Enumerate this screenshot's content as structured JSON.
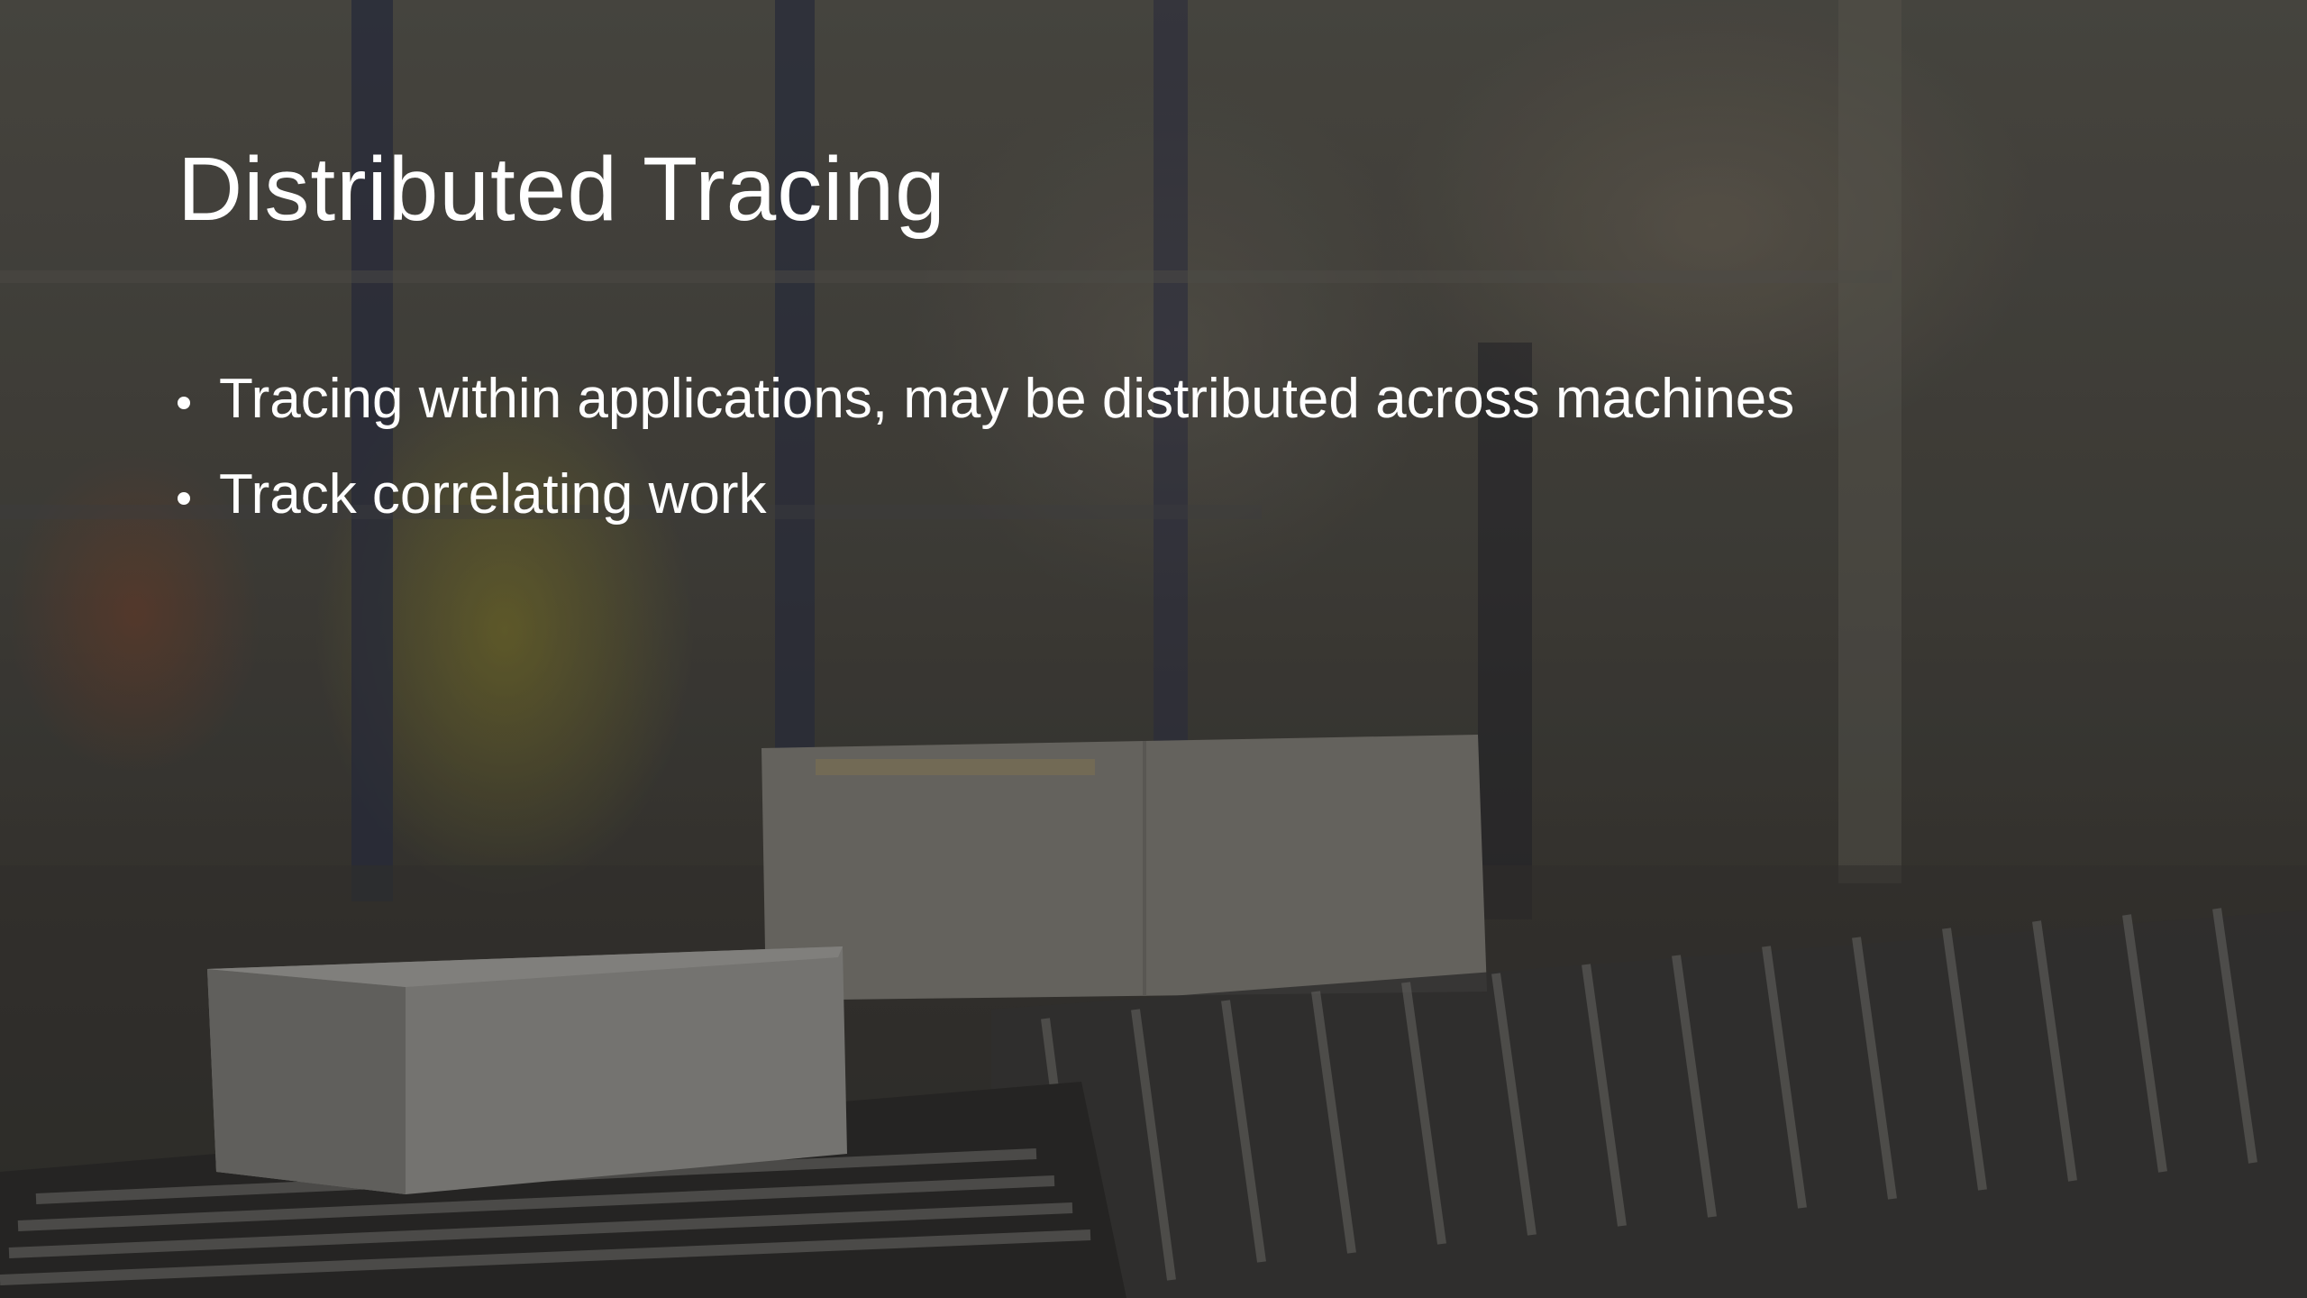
{
  "slide": {
    "title": "Distributed Tracing",
    "bullets": [
      "Tracing within applications, may be distributed across machines",
      "Track correlating work"
    ]
  },
  "background": {
    "description_icon": "warehouse-conveyor-photo",
    "tint_color": "#2a2926"
  }
}
